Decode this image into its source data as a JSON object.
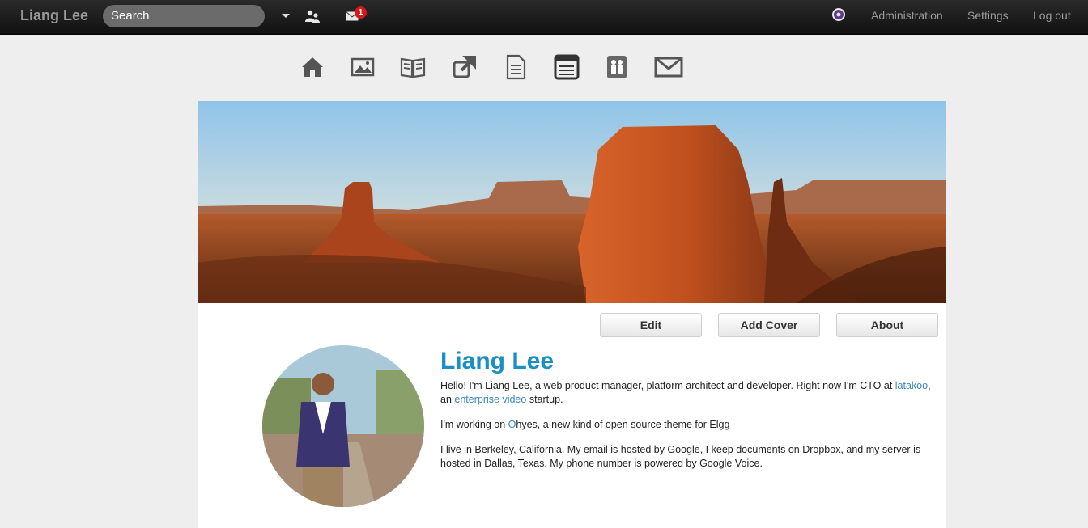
{
  "topbar": {
    "brand": "Liang Lee",
    "search_placeholder": "Search",
    "mail_count": "1",
    "links": {
      "administration": "Administration",
      "settings": "Settings",
      "logout": "Log out"
    }
  },
  "icon_menu": [
    "home-icon",
    "photos-icon",
    "blog-icon",
    "bookmarks-icon",
    "files-icon",
    "pages-icon",
    "groups-icon",
    "messages-icon"
  ],
  "profile": {
    "buttons": {
      "edit": "Edit",
      "add_cover": "Add Cover",
      "about": "About"
    },
    "name": "Liang Lee",
    "bio": {
      "p1_a": "Hello! I'm Liang Lee, a web product manager, platform architect and developer. Right now I'm CTO at ",
      "link_latakoo": "latakoo",
      "p1_b": ", an ",
      "link_video": "enterprise video",
      "p1_c": " startup.",
      "p2_a": "I'm working on ",
      "link_o": "O",
      "p2_b": "hyes, a new kind of open source theme for Elgg",
      "p3": "I live in Berkeley, California. My email is hosted by Google, I keep documents on Dropbox, and my server is hosted in Dallas, Texas. My phone number is powered by Google Voice."
    }
  },
  "colors": {
    "accent": "#1b8ec3",
    "link": "#3a84c4",
    "badge": "#d8171d",
    "topbar": "#161616"
  }
}
